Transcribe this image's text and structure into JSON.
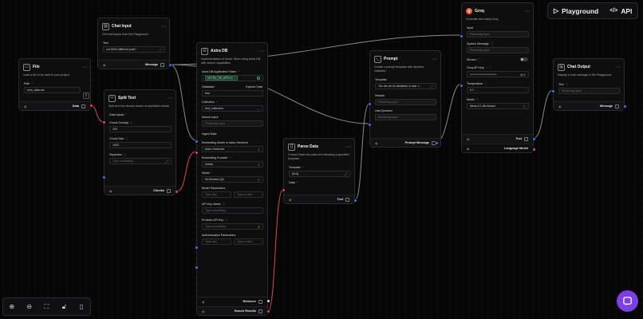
{
  "topbar": {
    "playground_label": "Playground",
    "api_label": "API"
  },
  "nodes": {
    "file": {
      "title": "File",
      "description": "Load a file to be used in your project.",
      "path_label": "Path",
      "path_value": "new_data.csv",
      "output_label": "Data"
    },
    "chat_input": {
      "title": "Chat Input",
      "description": "Get chat inputs from the Playground.",
      "text_label": "Text",
      "text_value": "cut 5000 different post?",
      "output_label": "Message"
    },
    "split_text": {
      "title": "Split Text",
      "description": "Split text into chunks based on specified criteria.",
      "data_inputs_label": "Data Inputs",
      "chunk_overlap_label": "Chunk Overlap",
      "chunk_overlap_value": "200",
      "chunk_size_label": "Chunk Size",
      "chunk_size_value": "1000",
      "separator_label": "Separator",
      "separator_placeholder": "Type something...",
      "output_label": "Chunks"
    },
    "astra_db": {
      "title": "Astra DB",
      "description": "Implementation of Vector Store using Astra DB with search capabilities",
      "token_label": "Astra DB Application Token",
      "token_value": "ASTRA_DB_APPLIC...",
      "database_label": "Database",
      "database_extra": "Explore Data",
      "database_value": "test",
      "collection_label": "Collection",
      "collection_value": "test_collection",
      "search_input_label": "Search Input",
      "search_input_placeholder": "Receiving input",
      "ingest_label": "Ingest Data",
      "embedding_model_label": "Embedding Model or Astra Vectorize",
      "embedding_model_value": "Astra Vectorize",
      "provider_label": "Embedding Provider",
      "provider_value": "Nvidia",
      "model_label": "Model",
      "model_value": "NV-Embed-QA",
      "model_params_label": "Model Parameters",
      "type_key_placeholder": "Type key...",
      "type_value_placeholder": "Type a valu...",
      "api_key_name_label": "API Key Name",
      "api_key_name_placeholder": "Type something...",
      "provider_api_key_label": "Provider API Key",
      "provider_api_key_placeholder": "Type something...",
      "auth_params_label": "Authentication Parameters",
      "retriever_label": "Retriever",
      "search_results_label": "Search Results"
    },
    "parse_data": {
      "title": "Parse Data",
      "description": "Convert Data into plain text following a specified template.",
      "template_label": "Template",
      "template_value": "{text}",
      "data_label": "Data",
      "output_label": "Text"
    },
    "prompt": {
      "title": "Prompt",
      "description": "Create a prompt template with dynamic variables.",
      "template_label": "Template",
      "template_value": "You are an AI assistant. A user I...",
      "results_label": "Results",
      "results_placeholder": "Receiving input",
      "user_question_label": "UserQuestion",
      "user_question_placeholder": "Receiving input",
      "output_label": "Prompt Message"
    },
    "groq": {
      "title": "Groq",
      "description": "Generate text using Groq.",
      "input_label": "Input",
      "input_placeholder": "Receiving input",
      "system_message_label": "System Message",
      "system_message_placeholder": "Receiving input",
      "stream_label": "Stream",
      "api_key_label": "Groq API Key",
      "api_key_value": "••••••••••••••••••••••••••••••••",
      "temperature_label": "Temperature",
      "temperature_value": "0.1",
      "model_label": "Model",
      "model_value": "llama-3.1-8b-instant",
      "text_output_label": "Text",
      "lm_output_label": "Language Model"
    },
    "chat_output": {
      "title": "Chat Output",
      "description": "Display a chat message in the Playground.",
      "text_label": "Text",
      "text_placeholder": "Receiving input",
      "output_label": "Message"
    }
  },
  "colors": {
    "handle_blue": "#4b6cf6",
    "handle_red": "#e0445a",
    "handle_pink": "#d63fb4",
    "handle_white": "#e5e5e5",
    "accent_purple": "#7b3fe4",
    "groq_orange": "#f25532"
  }
}
